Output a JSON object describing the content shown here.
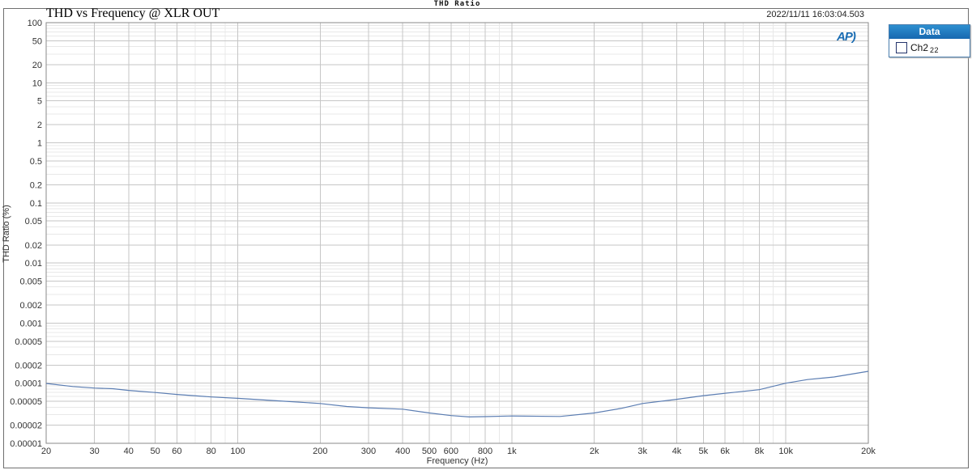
{
  "window": {
    "title": "THD Ratio"
  },
  "header": {
    "graph_title": "THD vs Frequency @ XLR OUT",
    "timestamp": "2022/11/11 16:03:04.503"
  },
  "logo": {
    "text": "AP",
    "swoosh": ")",
    "color": "#1b6db3"
  },
  "legend": {
    "header": "Data",
    "entries": [
      {
        "swatch_color": "#18307f",
        "label": "Ch2",
        "index": "22"
      }
    ]
  },
  "colors": {
    "curve": "#5b7db2",
    "grid_major": "#c6c6c6",
    "grid_minor": "#e8e8e8",
    "plot_border": "#8a8a8a",
    "tick_text": "#333333",
    "legend_header_bg": "#1a78c2"
  },
  "chart_data": {
    "type": "line",
    "title": "THD vs Frequency @ XLR OUT",
    "window_title": "THD Ratio",
    "xlabel": "Frequency (Hz)",
    "ylabel": "THD Ratio (%)",
    "x_scale": "log",
    "y_scale": "log",
    "xlim": [
      20,
      20000
    ],
    "ylim": [
      1e-05,
      100
    ],
    "grid": true,
    "legend_position": "outside-top-right",
    "x_ticks": [
      {
        "v": 20,
        "label": "20"
      },
      {
        "v": 30,
        "label": "30"
      },
      {
        "v": 40,
        "label": "40"
      },
      {
        "v": 50,
        "label": "50"
      },
      {
        "v": 60,
        "label": "60"
      },
      {
        "v": 80,
        "label": "80"
      },
      {
        "v": 100,
        "label": "100"
      },
      {
        "v": 200,
        "label": "200"
      },
      {
        "v": 300,
        "label": "300"
      },
      {
        "v": 400,
        "label": "400"
      },
      {
        "v": 500,
        "label": "500"
      },
      {
        "v": 600,
        "label": "600"
      },
      {
        "v": 800,
        "label": "800"
      },
      {
        "v": 1000,
        "label": "1k"
      },
      {
        "v": 2000,
        "label": "2k"
      },
      {
        "v": 3000,
        "label": "3k"
      },
      {
        "v": 4000,
        "label": "4k"
      },
      {
        "v": 5000,
        "label": "5k"
      },
      {
        "v": 6000,
        "label": "6k"
      },
      {
        "v": 8000,
        "label": "8k"
      },
      {
        "v": 10000,
        "label": "10k"
      },
      {
        "v": 20000,
        "label": "20k"
      }
    ],
    "y_ticks": [
      {
        "v": 100,
        "label": "100"
      },
      {
        "v": 50,
        "label": "50"
      },
      {
        "v": 20,
        "label": "20"
      },
      {
        "v": 10,
        "label": "10"
      },
      {
        "v": 5,
        "label": "5"
      },
      {
        "v": 2,
        "label": "2"
      },
      {
        "v": 1,
        "label": "1"
      },
      {
        "v": 0.5,
        "label": "0.5"
      },
      {
        "v": 0.2,
        "label": "0.2"
      },
      {
        "v": 0.1,
        "label": "0.1"
      },
      {
        "v": 0.05,
        "label": "0.05"
      },
      {
        "v": 0.02,
        "label": "0.02"
      },
      {
        "v": 0.01,
        "label": "0.01"
      },
      {
        "v": 0.005,
        "label": "0.005"
      },
      {
        "v": 0.002,
        "label": "0.002"
      },
      {
        "v": 0.001,
        "label": "0.001"
      },
      {
        "v": 0.0005,
        "label": "0.0005"
      },
      {
        "v": 0.0002,
        "label": "0.0002"
      },
      {
        "v": 0.0001,
        "label": "0.0001"
      },
      {
        "v": 5e-05,
        "label": "0.00005"
      },
      {
        "v": 2e-05,
        "label": "0.00002"
      },
      {
        "v": 1e-05,
        "label": "0.00001"
      }
    ],
    "series": [
      {
        "name": "Ch2 22",
        "color": "#5b7db2",
        "points": [
          [
            20,
            9.9e-05
          ],
          [
            25,
            8.8e-05
          ],
          [
            30,
            8.3e-05
          ],
          [
            35,
            8.1e-05
          ],
          [
            40,
            7.6e-05
          ],
          [
            50,
            7e-05
          ],
          [
            60,
            6.5e-05
          ],
          [
            80,
            5.9e-05
          ],
          [
            100,
            5.6e-05
          ],
          [
            150,
            5e-05
          ],
          [
            200,
            4.6e-05
          ],
          [
            250,
            4.1e-05
          ],
          [
            300,
            3.9e-05
          ],
          [
            400,
            3.7e-05
          ],
          [
            500,
            3.2e-05
          ],
          [
            600,
            2.9e-05
          ],
          [
            700,
            2.75e-05
          ],
          [
            800,
            2.78e-05
          ],
          [
            1000,
            2.85e-05
          ],
          [
            1500,
            2.8e-05
          ],
          [
            2000,
            3.2e-05
          ],
          [
            2500,
            3.8e-05
          ],
          [
            3000,
            4.6e-05
          ],
          [
            4000,
            5.4e-05
          ],
          [
            5000,
            6.2e-05
          ],
          [
            6000,
            6.8e-05
          ],
          [
            8000,
            7.8e-05
          ],
          [
            10000,
            0.0001
          ],
          [
            12000,
            0.000115
          ],
          [
            15000,
            0.000127
          ],
          [
            20000,
            0.000158
          ]
        ]
      }
    ]
  }
}
